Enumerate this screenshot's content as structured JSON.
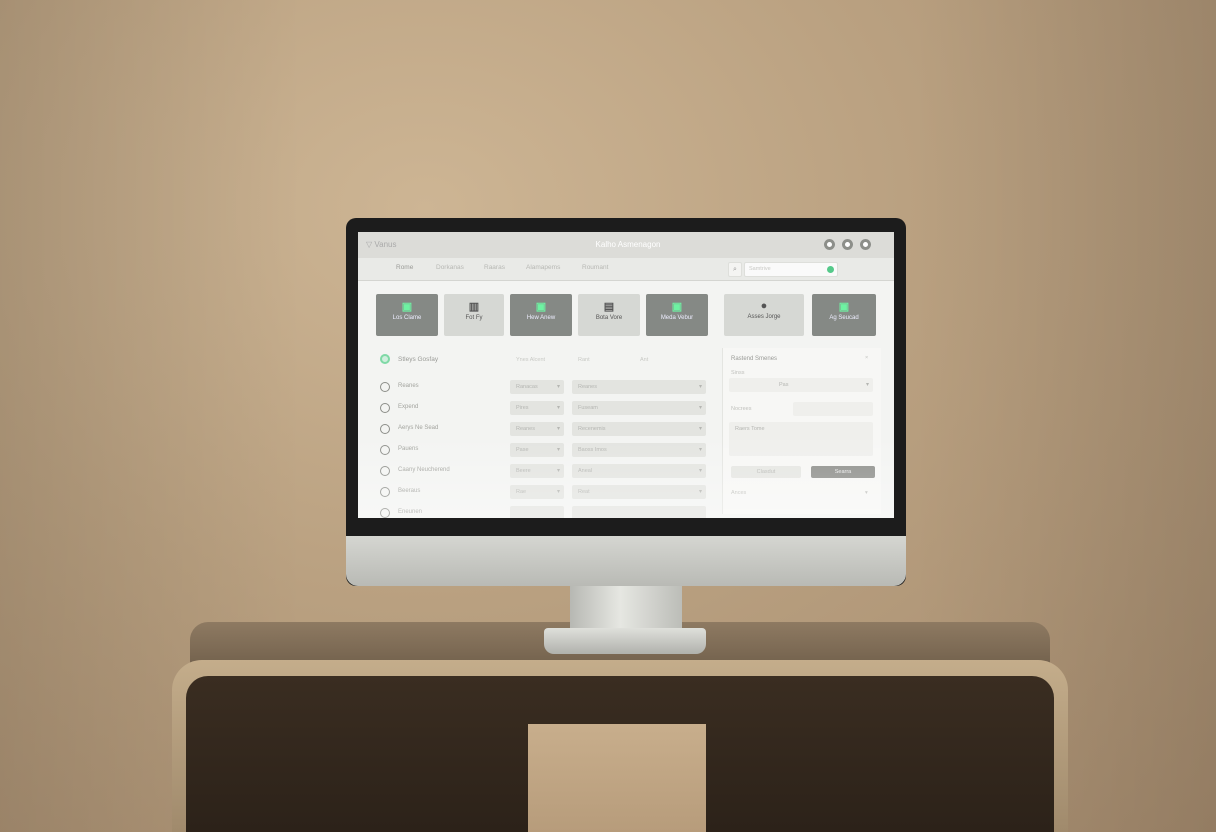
{
  "app": {
    "logo_text": "▽ Vanus",
    "title": "Kalho Asmenagon",
    "window_buttons": [
      "settings-icon",
      "info-icon",
      "close-icon"
    ]
  },
  "tabs": [
    {
      "label": "Rome",
      "active": true
    },
    {
      "label": "Dorkanas",
      "active": false
    },
    {
      "label": "Raaras",
      "active": false
    },
    {
      "label": "Alamapems",
      "active": false
    },
    {
      "label": "Roumant",
      "active": false
    }
  ],
  "search": {
    "placeholder": "Samtrive"
  },
  "tiles": [
    {
      "label": "Los Clame",
      "icon": "▣",
      "style": "dark"
    },
    {
      "label": "Fot Fy",
      "icon": "▥",
      "style": "light"
    },
    {
      "label": "Hew Anew",
      "icon": "▣",
      "style": "dark"
    },
    {
      "label": "Bota Vore",
      "icon": "▤",
      "style": "light"
    },
    {
      "label": "Meda Vebur",
      "icon": "▣",
      "style": "dark"
    },
    {
      "label": "Asses Jorge",
      "icon": "●",
      "style": "light"
    },
    {
      "label": "Ag Seucad",
      "icon": "▣",
      "style": "dark"
    }
  ],
  "section": {
    "title": "Stleys Gosfay",
    "col1": "Ynes Alcent",
    "col2": "Rant",
    "col3": "Ant"
  },
  "rows": [
    {
      "label": "Reanes",
      "sel1": "Ranacas",
      "sel2": "Reanes"
    },
    {
      "label": "Expend",
      "sel1": "Pires",
      "sel2": "Fuseam"
    },
    {
      "label": "Aerys Ne Sead",
      "sel1": "Reanes",
      "sel2": "Recenemis"
    },
    {
      "label": "Pauens",
      "sel1": "Pase",
      "sel2": "Baoss Imos"
    },
    {
      "label": "Caany Neucherend",
      "sel1": "Beere",
      "sel2": "Aneal"
    },
    {
      "label": "Beeraus",
      "sel1": "Rae",
      "sel2": "Reat"
    },
    {
      "label": "Eneunen",
      "sel1": "",
      "sel2": ""
    }
  ],
  "panel": {
    "title": "Rastend Smenes",
    "field1_label": "Sinss",
    "field1_value": "Pas",
    "field2_label": "Nocrees",
    "field3_label": "Raers Tome",
    "cancel_label": "Clasdut",
    "save_label": "Searra",
    "footer_label": "Ances"
  }
}
